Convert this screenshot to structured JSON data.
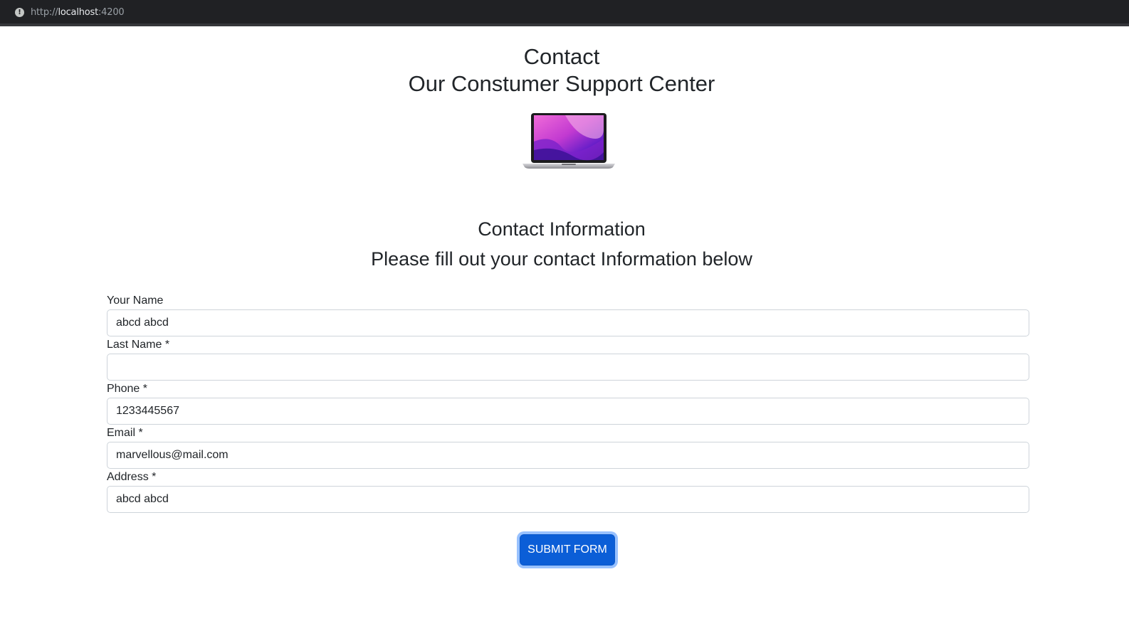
{
  "browser": {
    "url_scheme": "http://",
    "url_host": "localhost",
    "url_port": ":4200",
    "info_icon": "info-icon"
  },
  "header": {
    "title": "Contact",
    "subtitle": "Our Constumer Support Center",
    "image": "laptop-image"
  },
  "section": {
    "title": "Contact Information",
    "subtitle": "Please fill out your contact Information below"
  },
  "form": {
    "name": {
      "label": "Your Name",
      "value": "abcd abcd"
    },
    "last_name": {
      "label": "Last Name *",
      "value": ""
    },
    "phone": {
      "label": "Phone *",
      "value": "1233445567"
    },
    "email": {
      "label": "Email *",
      "value": "marvellous@mail.com"
    },
    "address": {
      "label": "Address *",
      "value": "abcd abcd"
    },
    "submit_label": "SUBMIT FORM"
  },
  "colors": {
    "primary": "#0b5ed7",
    "text": "#212529",
    "border": "#ced4da"
  }
}
